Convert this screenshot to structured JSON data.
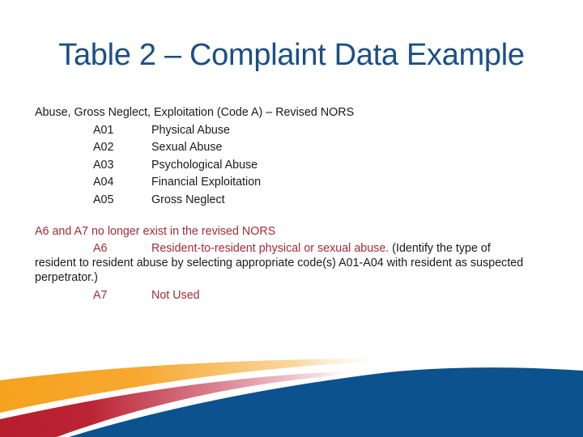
{
  "slide": {
    "title": "Table 2 – Complaint Data Example",
    "section_heading": "Abuse, Gross Neglect, Exploitation (Code A) – Revised NORS",
    "codes": [
      {
        "code": "A01",
        "description": "Physical Abuse"
      },
      {
        "code": "A02",
        "description": "Sexual Abuse"
      },
      {
        "code": "A03",
        "description": "Psychological Abuse"
      },
      {
        "code": "A04",
        "description": "Financial Exploitation"
      },
      {
        "code": "A05",
        "description": "Gross Neglect"
      }
    ],
    "removed_heading": "A6 and A7 no longer exist in the revised NORS",
    "removed_codes": [
      {
        "code": "A6",
        "description": "Resident-to-resident physical or sexual abuse.",
        "note_first": " (Identify the type of",
        "note_rest": "resident to resident abuse by selecting appropriate code(s) A01-A04 with resident as suspected perpetrator.)"
      },
      {
        "code": "A7",
        "description": "Not Used"
      }
    ]
  },
  "colors": {
    "title": "#1c4f85",
    "text": "#1a1a1a",
    "removed_text": "#a52a3a",
    "swoosh_orange": "#f5a623",
    "swoosh_red": "#b81e2d",
    "swoosh_blue": "#0b528f"
  }
}
